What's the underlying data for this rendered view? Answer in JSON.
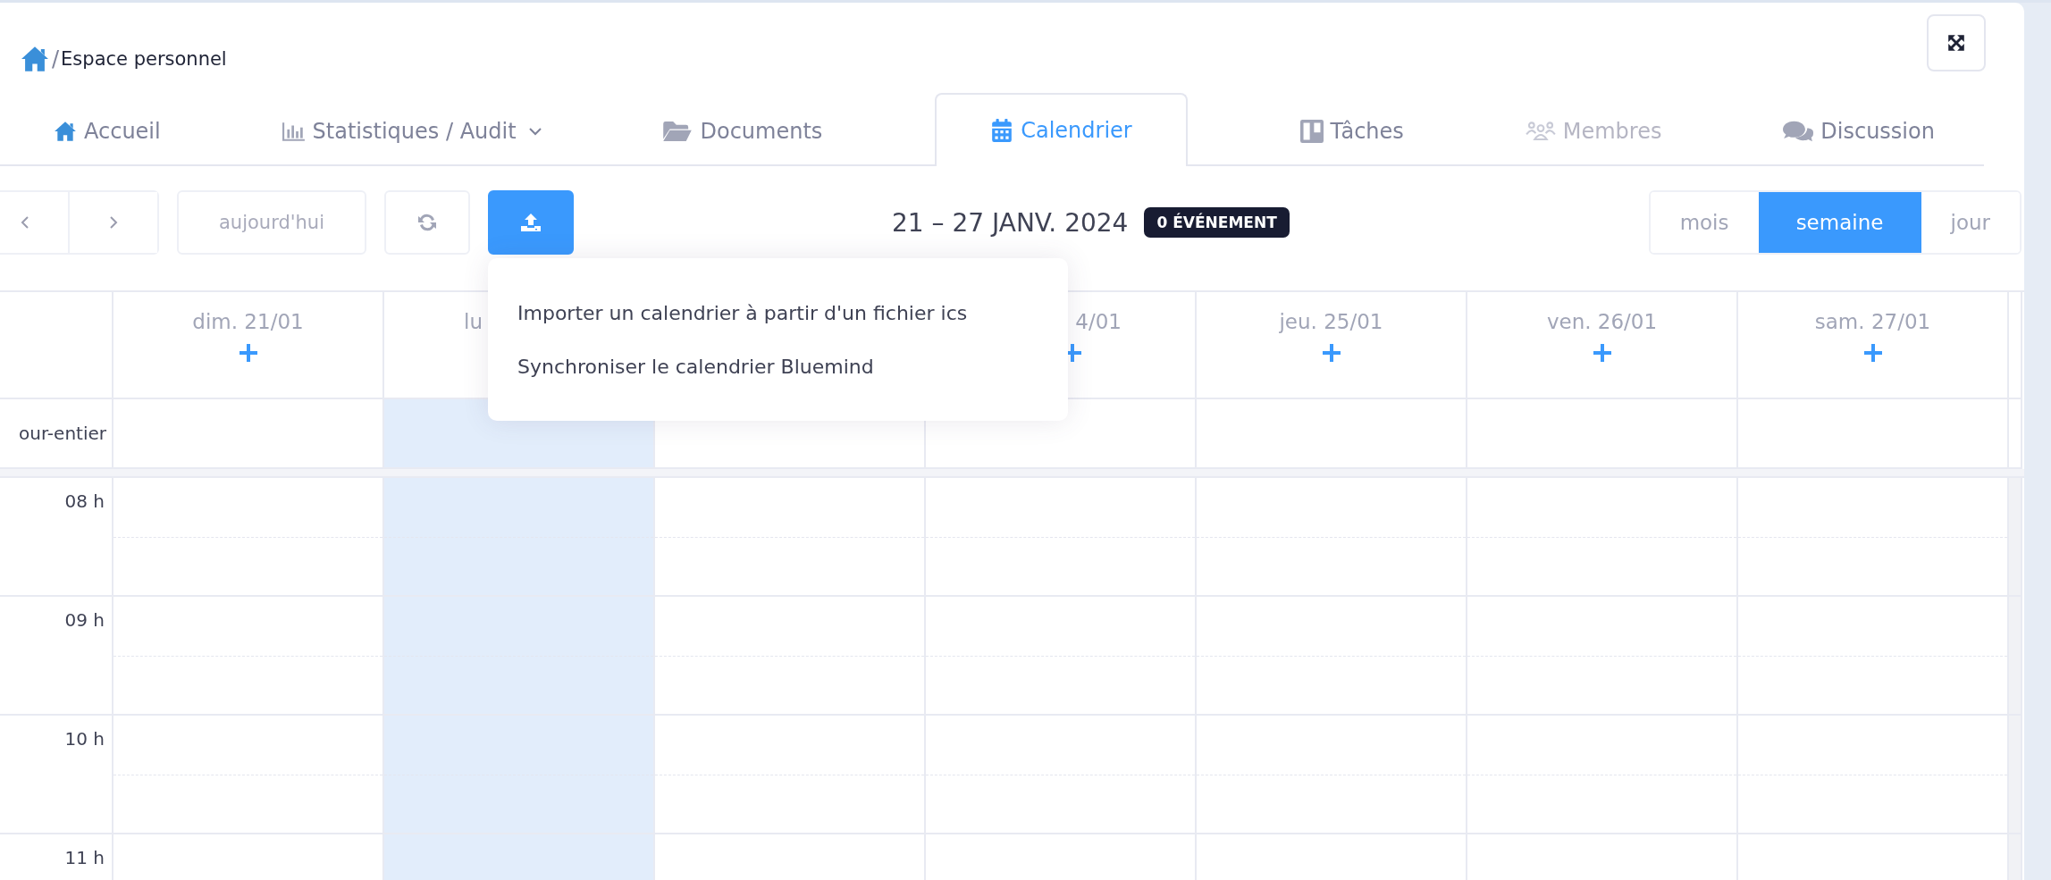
{
  "breadcrumb": {
    "separator": "/",
    "label": "Espace personnel"
  },
  "tabs": [
    {
      "label": "Accueil",
      "selected": false,
      "disabled": false,
      "dropdown": false
    },
    {
      "label": "Statistiques / Audit",
      "selected": false,
      "disabled": false,
      "dropdown": true
    },
    {
      "label": "Documents",
      "selected": false,
      "disabled": false,
      "dropdown": false
    },
    {
      "label": "Calendrier",
      "selected": true,
      "disabled": false,
      "dropdown": false
    },
    {
      "label": "Tâches",
      "selected": false,
      "disabled": false,
      "dropdown": false
    },
    {
      "label": "Membres",
      "selected": false,
      "disabled": true,
      "dropdown": false
    },
    {
      "label": "Discussion",
      "selected": false,
      "disabled": false,
      "dropdown": false
    }
  ],
  "toolbar": {
    "today_button": {
      "label": "aujourd'hui",
      "disabled": true
    },
    "title": "21 – 27 JANV. 2024",
    "badge": "0 ÉVÉNEMENT",
    "views": [
      {
        "label": "mois",
        "selected": false
      },
      {
        "label": "semaine",
        "selected": true
      },
      {
        "label": "jour",
        "selected": false
      }
    ]
  },
  "import_menu": {
    "items": [
      "Importer un calendrier à partir d'un fichier ics",
      "Synchroniser le calendrier Bluemind"
    ]
  },
  "calendar": {
    "all_day_label": "our-entier",
    "days": [
      {
        "label": "dim. 21/01",
        "add": true,
        "today": false
      },
      {
        "label": "lu",
        "add": false,
        "today": true,
        "cut_end": true
      },
      {
        "today": false
      },
      {
        "label": "4/01",
        "add": true,
        "today": false,
        "cut_start": true
      },
      {
        "label": "jeu. 25/01",
        "add": true,
        "today": false
      },
      {
        "label": "ven. 26/01",
        "add": true,
        "today": false
      },
      {
        "label": "sam. 27/01",
        "add": true,
        "today": false
      }
    ],
    "hours": [
      "08 h",
      "09 h",
      "10 h",
      "11 h"
    ]
  }
}
